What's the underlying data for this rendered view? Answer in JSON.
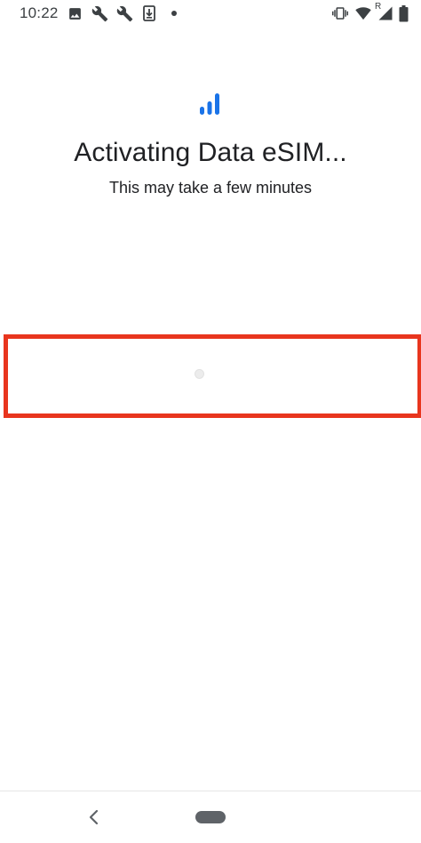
{
  "status_bar": {
    "time": "10:22",
    "left_icons": [
      "image-icon",
      "wrench-icon",
      "wrench-icon",
      "download-icon",
      "dot-icon"
    ],
    "right_icons": [
      "vibrate-icon",
      "wifi-icon",
      "signal-icon",
      "battery-icon"
    ],
    "roaming_label": "R"
  },
  "header": {
    "logo_icon": "signal-bars-icon",
    "title": "Activating Data eSIM...",
    "subtitle": "This may take a few minutes"
  },
  "progress": {
    "indicator_icon": "loading-spinner-icon"
  },
  "nav_bar": {
    "back_icon": "back-chevron-icon",
    "home_icon": "home-pill-icon"
  },
  "colors": {
    "accent_blue": "#1a73e8",
    "highlight_red": "#e8351e",
    "text_primary": "#202124",
    "nav_gray": "#5f6368"
  }
}
